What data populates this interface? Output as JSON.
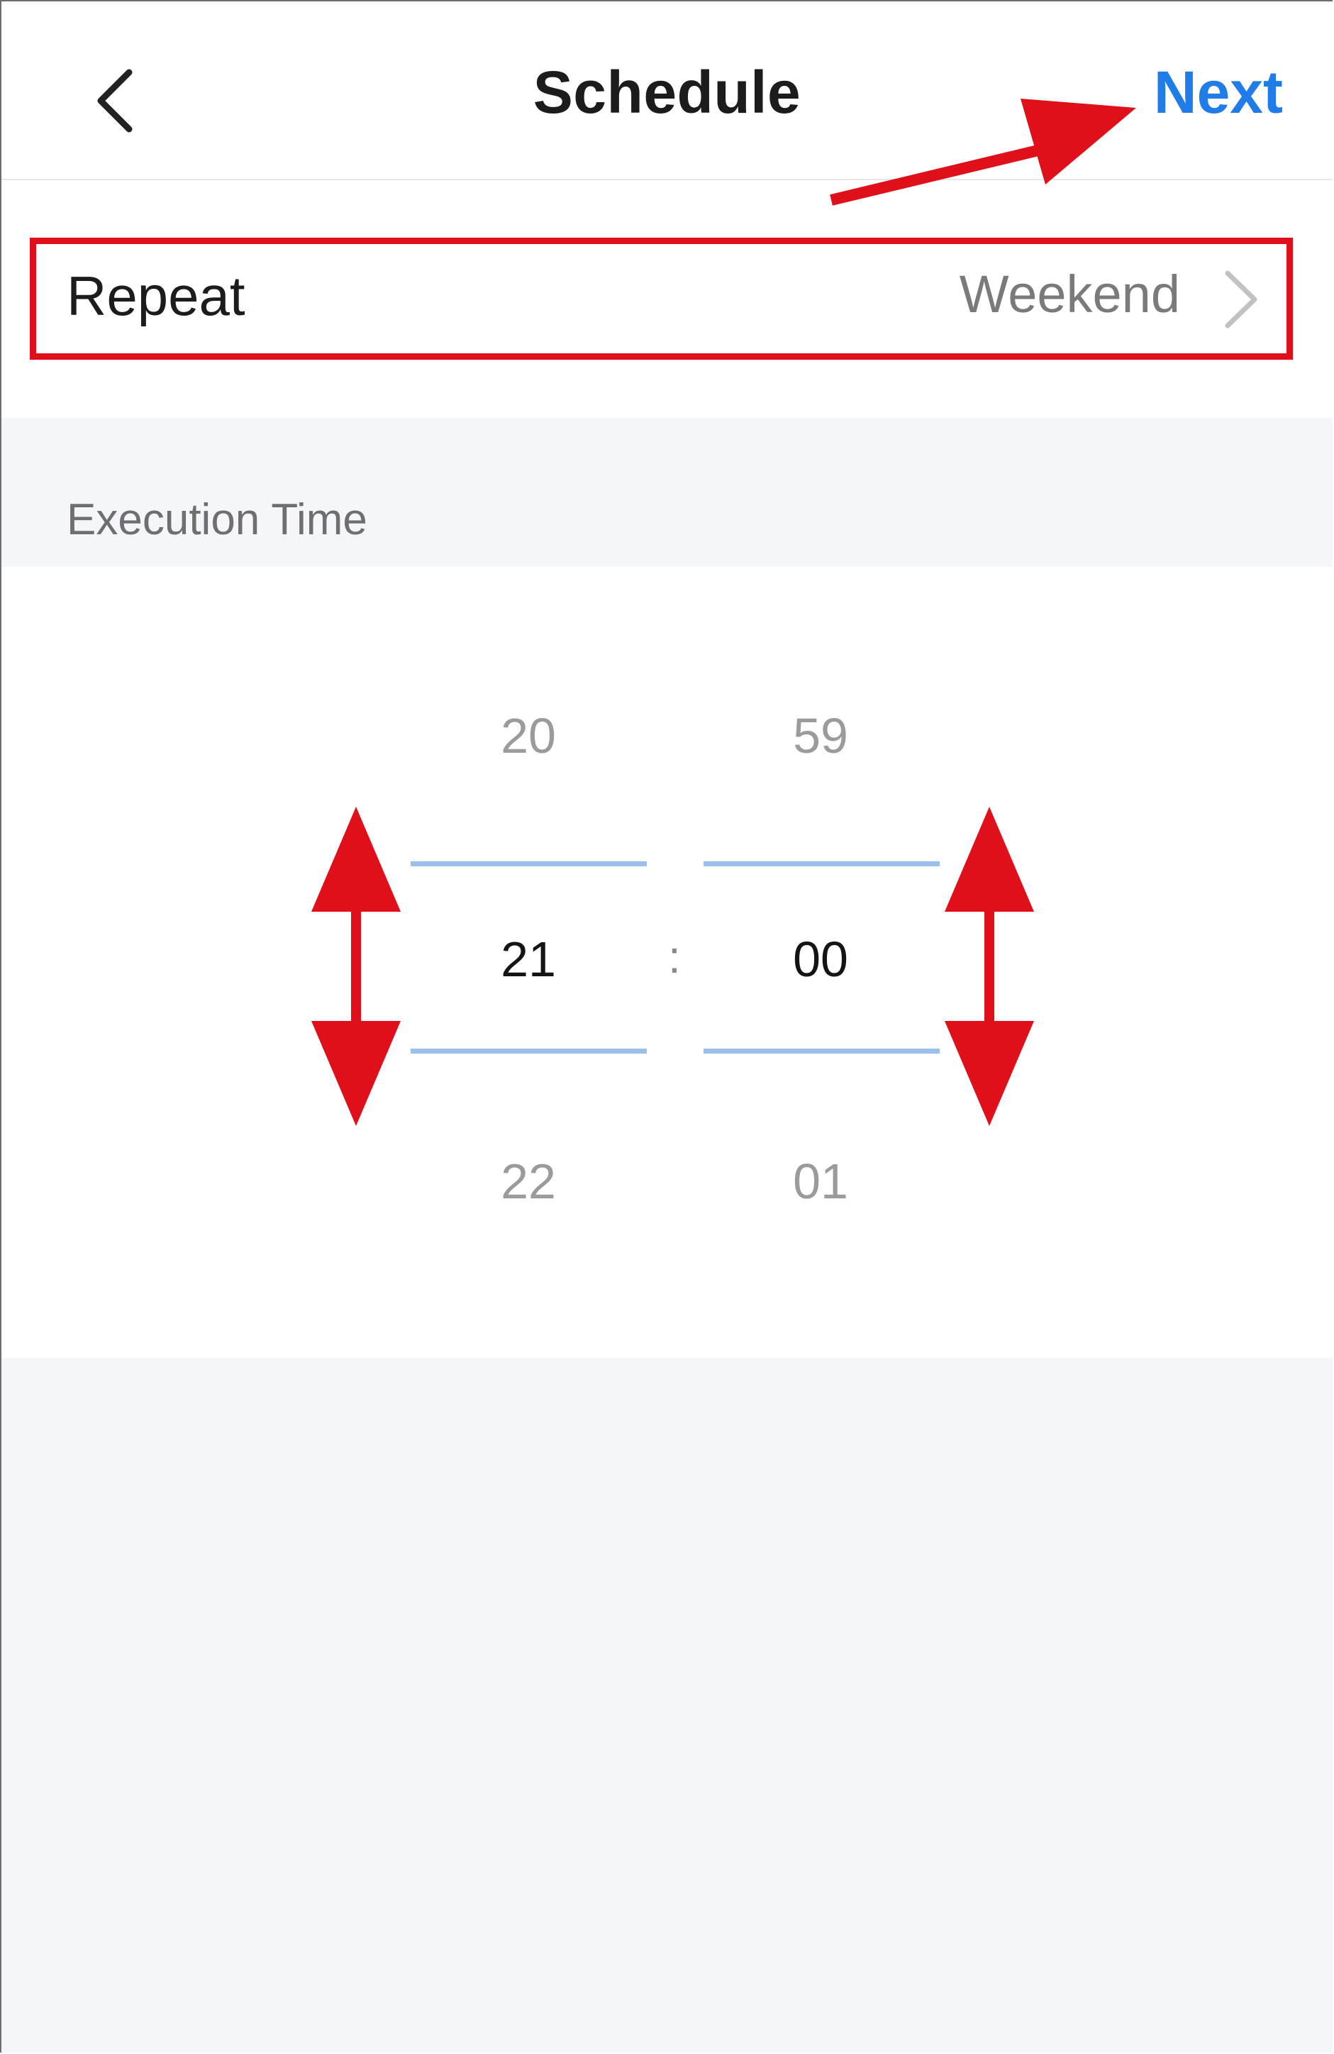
{
  "header": {
    "title": "Schedule",
    "next_label": "Next",
    "back_icon": "chevron-left-icon"
  },
  "repeat": {
    "label": "Repeat",
    "value": "Weekend",
    "chevron_icon": "chevron-right-icon"
  },
  "execution": {
    "section_title": "Execution Time",
    "separator": ":",
    "hours": {
      "prev": "20",
      "selected": "21",
      "next": "22"
    },
    "minutes": {
      "prev": "59",
      "selected": "00",
      "next": "01"
    }
  },
  "colors": {
    "accent_blue": "#1f7ce8",
    "annotation_red": "#e0101a",
    "selection_line": "#9ac0ee",
    "section_bg": "#f4f6fa"
  }
}
